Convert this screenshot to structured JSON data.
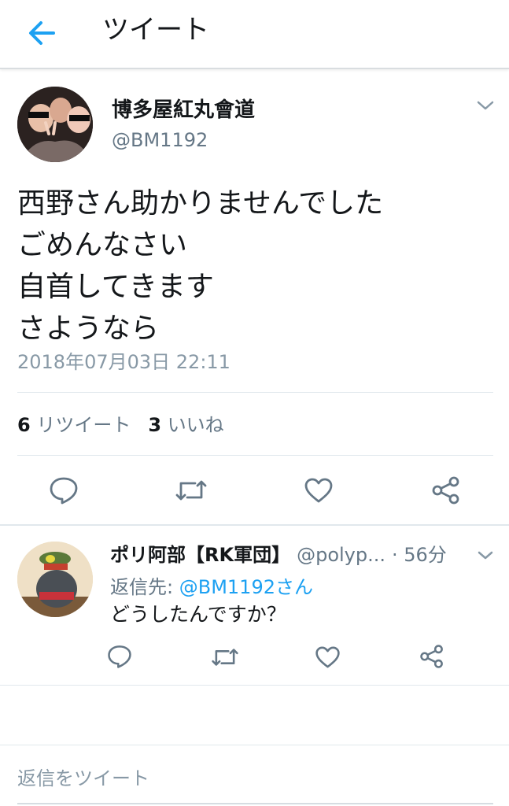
{
  "header": {
    "title": "ツイート",
    "back_icon": "arrow-left-icon",
    "accent": "#1da1f2"
  },
  "tweet": {
    "author_name": "博多屋紅丸會道",
    "author_handle": "@BM1192",
    "text_lines": [
      "西野さん助かりませんでした",
      "ごめんなさい",
      "自首してきます",
      "さようなら"
    ],
    "timestamp": "2018年07月03日 22:11",
    "retweet_count": "6",
    "retweet_label": "リツイート",
    "like_count": "3",
    "like_label": "いいね",
    "actions": [
      "reply-icon",
      "retweet-icon",
      "like-icon",
      "share-icon"
    ]
  },
  "reply": {
    "author_name": "ポリ阿部【RK軍団】",
    "author_handle": "@polyp...",
    "time": "· 56分",
    "reply_to_label": "返信先:",
    "reply_to_handle": "@BM1192さん",
    "text": "どうしたんですか？",
    "actions": [
      "reply-icon",
      "retweet-icon",
      "like-icon",
      "share-icon"
    ]
  },
  "compose": {
    "placeholder": "返信をツイート"
  }
}
